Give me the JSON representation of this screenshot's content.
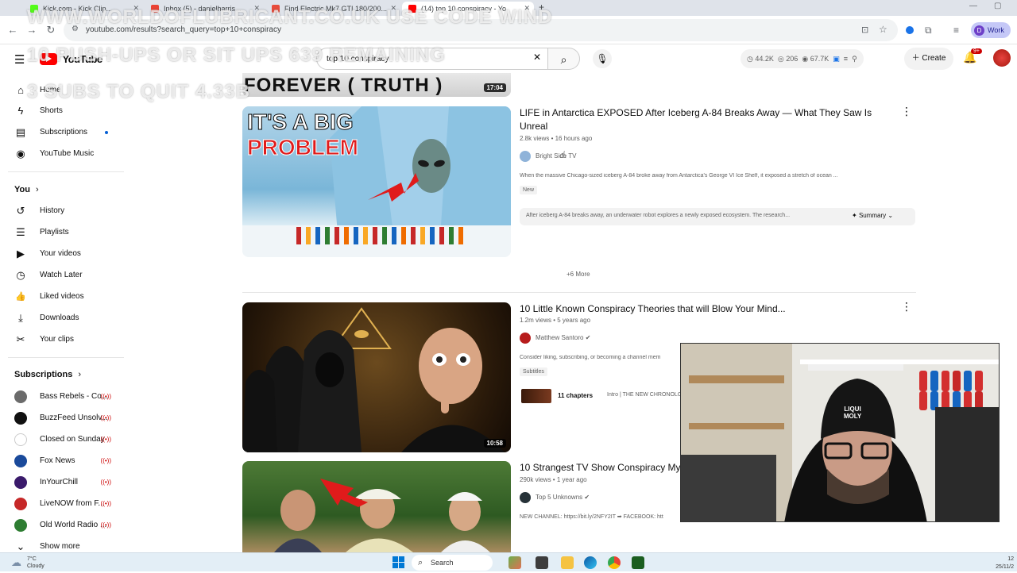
{
  "browser": {
    "tabs": [
      {
        "label": "Kick.com - Kick Clip...",
        "color": "#53fc18"
      },
      {
        "label": "Inbox (5) - danielharris...",
        "color": "#ea4335"
      },
      {
        "label": "Find Electric Mk7 GTI 180/200...",
        "color": "#e74c3c"
      },
      {
        "label": "(14) top 10 conspiracy - Yo",
        "color": "#ff0000"
      }
    ],
    "new_tab": "+",
    "url": "youtube.com/results?search_query=top+10+conspiracy",
    "profile_label": "Work",
    "profile_initial": "D"
  },
  "watermark": {
    "line1": "WWW.WORLDOFLUBRICANT.CO.UK USE CODE WIND",
    "line2": "10 PUSH-UPS OR SIT UPS 639 REMAINING",
    "line3": "3 SUBS TO QUIT 4.33B"
  },
  "youtube": {
    "logo_text": "YouTube",
    "search_value": "top 10 conspiracy",
    "stats": {
      "views": "44.2K",
      "watching": "206",
      "subs": "67.7K"
    },
    "create_label": "Create",
    "notif_count": "9+"
  },
  "sidebar": {
    "top": [
      {
        "label": "Home",
        "icon": "home-icon",
        "glyph": "⌂"
      },
      {
        "label": "Shorts",
        "icon": "shorts-icon",
        "glyph": "ϟ"
      },
      {
        "label": "Subscriptions",
        "icon": "subscriptions-icon",
        "glyph": "▤"
      },
      {
        "label": "YouTube Music",
        "icon": "music-icon",
        "glyph": "◉"
      }
    ],
    "you_header": "You",
    "you": [
      {
        "label": "History",
        "icon": "history-icon",
        "glyph": "↺"
      },
      {
        "label": "Playlists",
        "icon": "playlists-icon",
        "glyph": "☰"
      },
      {
        "label": "Your videos",
        "icon": "your-videos-icon",
        "glyph": "▶"
      },
      {
        "label": "Watch Later",
        "icon": "watch-later-icon",
        "glyph": "◷"
      },
      {
        "label": "Liked videos",
        "icon": "like-icon",
        "glyph": "👍"
      },
      {
        "label": "Downloads",
        "icon": "download-icon",
        "glyph": "⤓"
      },
      {
        "label": "Your clips",
        "icon": "clips-icon",
        "glyph": "✂"
      }
    ],
    "subs_header": "Subscriptions",
    "subs": [
      {
        "label": "Bass Rebels - Co...",
        "color": "#6b6b6b"
      },
      {
        "label": "BuzzFeed Unsolv...",
        "color": "#111111"
      },
      {
        "label": "Closed on Sunday",
        "color": "#ffffff"
      },
      {
        "label": "Fox News",
        "color": "#1a4a9b"
      },
      {
        "label": "InYourChill",
        "color": "#3a1a6b"
      },
      {
        "label": "LiveNOW from F...",
        "color": "#c62828"
      },
      {
        "label": "Old World Radio ...",
        "color": "#2e7d32"
      }
    ],
    "show_more": "Show more"
  },
  "results": {
    "prev_duration": "17:04",
    "prev_thumb_text": "FOREVER ( TRUTH )",
    "video1": {
      "title": "LIFE in Antarctica EXPOSED After Iceberg A-84 Breaks Away — What They Saw Is Unreal",
      "meta": "2.8k views • 16 hours ago",
      "channel": "Bright Side TV",
      "desc": "When the massive Chicago-sized iceberg A-84 broke away from Antarctica's George VI Ice Shelf, it exposed a stretch of ocean ...",
      "badge": "New",
      "thumb_line1": "IT'S A BIG",
      "thumb_line2": "PROBLEM",
      "summary": "After iceberg A-84 breaks away, an underwater robot explores a newly exposed ecosystem. The research...",
      "summary_btn": "Summary",
      "more": "+6 More"
    },
    "video2": {
      "title": "10 Little Known Conspiracy Theories that will Blow Your Mind...",
      "meta": "1.2m views • 5 years ago",
      "channel": "Matthew Santoro",
      "desc": "Consider liking, subscribing, or becoming a channel mem",
      "badge": "Subtitles",
      "chapters": "11 chapters",
      "chapter_text": "Intro | THE NEW CHRONOLOG",
      "duration": "10:58"
    },
    "video3": {
      "title": "10 Strangest TV Show Conspiracy My",
      "meta": "290k views • 1 year ago",
      "channel": "Top 5 Unknowns",
      "desc": "NEW CHANNEL: https://bit.ly/2NFY2IT ➡ FACEBOOK: htt"
    }
  },
  "taskbar": {
    "temp": "7°C",
    "weather": "Cloudy",
    "search": "Search",
    "time": "12",
    "date": "25/11/2"
  },
  "webcam": {
    "cap_text": "LIQUI MOLY"
  }
}
